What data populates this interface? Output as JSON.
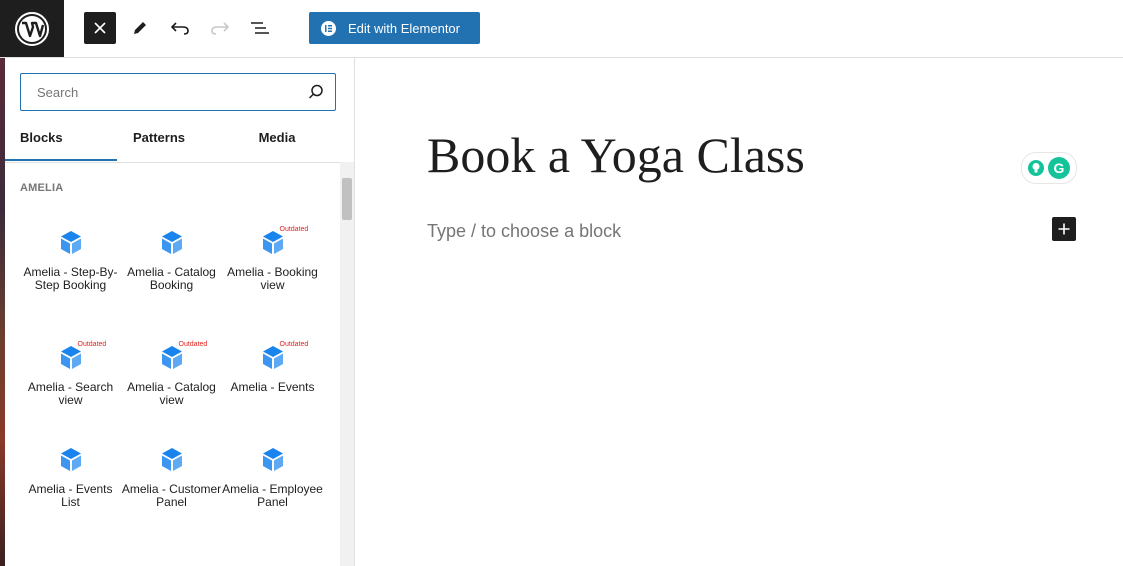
{
  "toolbar": {
    "elementor_label": "Edit with Elementor"
  },
  "inserter": {
    "search": {
      "placeholder": "Search",
      "value": ""
    },
    "tabs": [
      {
        "label": "Blocks"
      },
      {
        "label": "Patterns"
      },
      {
        "label": "Media"
      }
    ],
    "category": "AMELIA",
    "blocks": [
      {
        "label": "Amelia - Step-By-Step Booking",
        "outdated": false
      },
      {
        "label": "Amelia - Catalog Booking",
        "outdated": false
      },
      {
        "label": "Amelia - Booking view",
        "outdated": true
      },
      {
        "label": "Amelia - Search view",
        "outdated": true
      },
      {
        "label": "Amelia - Catalog view",
        "outdated": true
      },
      {
        "label": "Amelia - Events",
        "outdated": true
      },
      {
        "label": "Amelia - Events List",
        "outdated": false
      },
      {
        "label": "Amelia - Customer Panel",
        "outdated": false
      },
      {
        "label": "Amelia - Employee Panel",
        "outdated": false
      }
    ],
    "outdated_badge": "Outdated"
  },
  "editor": {
    "title": "Book a Yoga Class",
    "block_placeholder": "Type / to choose a block"
  },
  "colors": {
    "accent": "#2271b1",
    "amelia_icon": "#1a84ee",
    "grammarly": "#15c39a",
    "dark": "#1e1e1e"
  },
  "icons": [
    "wordpress-logo-icon",
    "close-icon",
    "pencil-icon",
    "undo-icon",
    "redo-icon",
    "list-view-icon",
    "elementor-icon",
    "search-icon",
    "amelia-block-icon",
    "grammarly-icon",
    "plus-icon"
  ]
}
